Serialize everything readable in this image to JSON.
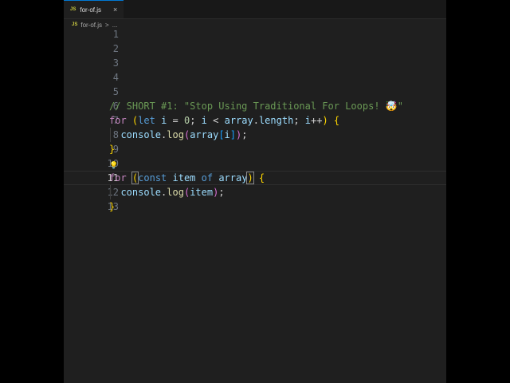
{
  "tab": {
    "icon": "JS",
    "label": "for-of.js",
    "close": "×"
  },
  "breadcrumb": {
    "icon": "JS",
    "file": "for-of.js",
    "sep": ">",
    "more": "..."
  },
  "current_line": 11,
  "lines": [
    {
      "n": "1",
      "tokens": []
    },
    {
      "n": "2",
      "tokens": []
    },
    {
      "n": "3",
      "tokens": []
    },
    {
      "n": "4",
      "tokens": []
    },
    {
      "n": "5",
      "tokens": []
    },
    {
      "n": "6",
      "tokens": [
        {
          "t": "// SHORT #1: \"Stop Using Traditional For Loops! 🤯\"",
          "k": "comment"
        }
      ]
    },
    {
      "n": "7",
      "tokens": [
        {
          "t": "for",
          "k": "kw"
        },
        {
          "t": " ",
          "k": "plain"
        },
        {
          "t": "(",
          "k": "b1"
        },
        {
          "t": "let",
          "k": "st"
        },
        {
          "t": " i ",
          "k": "var"
        },
        {
          "t": "= ",
          "k": "plain"
        },
        {
          "t": "0",
          "k": "num"
        },
        {
          "t": "; ",
          "k": "plain"
        },
        {
          "t": "i",
          "k": "var"
        },
        {
          "t": " < ",
          "k": "plain"
        },
        {
          "t": "array",
          "k": "var"
        },
        {
          "t": ".",
          "k": "plain"
        },
        {
          "t": "length",
          "k": "var"
        },
        {
          "t": "; ",
          "k": "plain"
        },
        {
          "t": "i",
          "k": "var"
        },
        {
          "t": "++",
          "k": "plain"
        },
        {
          "t": ")",
          "k": "b1"
        },
        {
          "t": " ",
          "k": "plain"
        },
        {
          "t": "{",
          "k": "b1"
        }
      ]
    },
    {
      "n": "8",
      "guide": true,
      "tokens": [
        {
          "t": "  console",
          "k": "var"
        },
        {
          "t": ".",
          "k": "plain"
        },
        {
          "t": "log",
          "k": "fn"
        },
        {
          "t": "(",
          "k": "b2"
        },
        {
          "t": "array",
          "k": "var"
        },
        {
          "t": "[",
          "k": "b3"
        },
        {
          "t": "i",
          "k": "var"
        },
        {
          "t": "]",
          "k": "b3"
        },
        {
          "t": ")",
          "k": "b2"
        },
        {
          "t": ";",
          "k": "plain"
        }
      ]
    },
    {
      "n": "9",
      "tokens": [
        {
          "t": "}",
          "k": "b1"
        }
      ]
    },
    {
      "n": "10",
      "bulb": true,
      "tokens": []
    },
    {
      "n": "11",
      "tokens": [
        {
          "t": "for",
          "k": "kw"
        },
        {
          "t": " ",
          "k": "plain"
        },
        {
          "t": "(",
          "k": "b1",
          "box": true
        },
        {
          "t": "const",
          "k": "st"
        },
        {
          "t": " item ",
          "k": "var"
        },
        {
          "t": "of",
          "k": "st"
        },
        {
          "t": " array",
          "k": "var"
        },
        {
          "t": ")",
          "k": "b1",
          "box": true
        },
        {
          "t": " ",
          "k": "plain"
        },
        {
          "t": "{",
          "k": "b1"
        }
      ]
    },
    {
      "n": "12",
      "guide": true,
      "tokens": [
        {
          "t": "  console",
          "k": "var"
        },
        {
          "t": ".",
          "k": "plain"
        },
        {
          "t": "log",
          "k": "fn"
        },
        {
          "t": "(",
          "k": "b2"
        },
        {
          "t": "item",
          "k": "var"
        },
        {
          "t": ")",
          "k": "b2"
        },
        {
          "t": ";",
          "k": "plain"
        }
      ]
    },
    {
      "n": "13",
      "tokens": [
        {
          "t": "}",
          "k": "b1"
        }
      ]
    }
  ]
}
